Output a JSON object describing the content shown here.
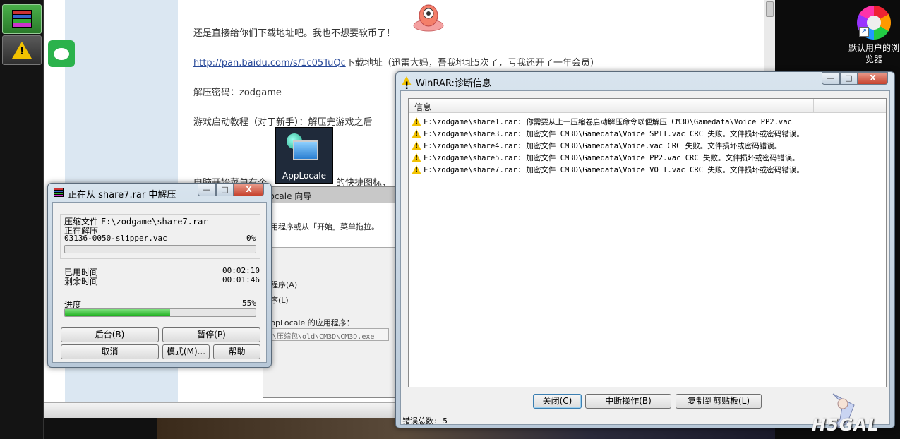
{
  "desktop": {
    "right_icon_label": "默认用户的浏览器",
    "watermark": "H5GAL"
  },
  "browser": {
    "lines": {
      "line1": "还是直接给你们下载地址吧。我也不想要软币了！",
      "link": "http://pan.baidu.com/s/1c05TuQc",
      "link_suffix": "下载地址（迅雷大妈，吾我地址5次了，亏我还开了一年会员）",
      "password": "解压密码：zodgame",
      "tutorial": "游戏启动教程（对于新手）：解压完游戏之后",
      "start_menu": "电脑开始菜单有个",
      "shortcut": "的快捷图标，"
    },
    "applocale_icon_label": "AppLocale"
  },
  "wizard": {
    "title": "Locale 向导",
    "pane_text": "用程序或从「开始」菜单拖拉。",
    "option_a": "程序(A)",
    "option_l": "序(L)",
    "app_label": "ppLocale 的应用程序：",
    "path_value": "\\压缩包\\old\\CM3D\\CM3D.exe"
  },
  "extract_dialog": {
    "title": "正在从 share7.rar 中解压",
    "archive_label": "压缩文件",
    "archive_path": "F:\\zodgame\\share7.rar",
    "status": "正在解压",
    "current_file": "03136-0050-slipper.vac",
    "file_percent": "0%",
    "file_progress": 0,
    "elapsed_label": "已用时间",
    "elapsed_value": "00:02:10",
    "remaining_label": "剩余时间",
    "remaining_value": "00:01:46",
    "progress_label": "进度",
    "progress_percent": "55%",
    "total_progress": 55,
    "buttons": {
      "background": "后台(B)",
      "pause": "暂停(P)",
      "cancel": "取消",
      "mode": "模式(M)...",
      "help": "帮助"
    },
    "controls": {
      "minimize": "—",
      "maximize": "□",
      "close": "X"
    }
  },
  "diag_dialog": {
    "title": "WinRAR:诊断信息",
    "column_header": "信息",
    "rows": [
      "F:\\zodgame\\share1.rar: 你需要从上一压缩卷启动解压命令以便解压 CM3D\\Gamedata\\Voice_PP2.vac",
      "F:\\zodgame\\share3.rar: 加密文件 CM3D\\Gamedata\\Voice_SPII.vac CRC 失败。文件损坏或密码错误。",
      "F:\\zodgame\\share4.rar: 加密文件 CM3D\\Gamedata\\Voice.vac CRC 失败。文件损坏或密码错误。",
      "F:\\zodgame\\share5.rar: 加密文件 CM3D\\Gamedata\\Voice_PP2.vac CRC 失败。文件损坏或密码错误。",
      "F:\\zodgame\\share7.rar: 加密文件 CM3D\\Gamedata\\Voice_VO_I.vac CRC 失败。文件损坏或密码错误。"
    ],
    "buttons": {
      "close": "关闭(C)",
      "abort": "中断操作(B)",
      "copy": "复制到剪贴板(L)"
    },
    "error_total": "错误总数: 5",
    "controls": {
      "minimize": "—",
      "maximize": "□",
      "close": "X"
    }
  },
  "colors": {
    "progress_fill": "#20b020",
    "warning": "#f2c200",
    "close_button": "#c7432e"
  }
}
